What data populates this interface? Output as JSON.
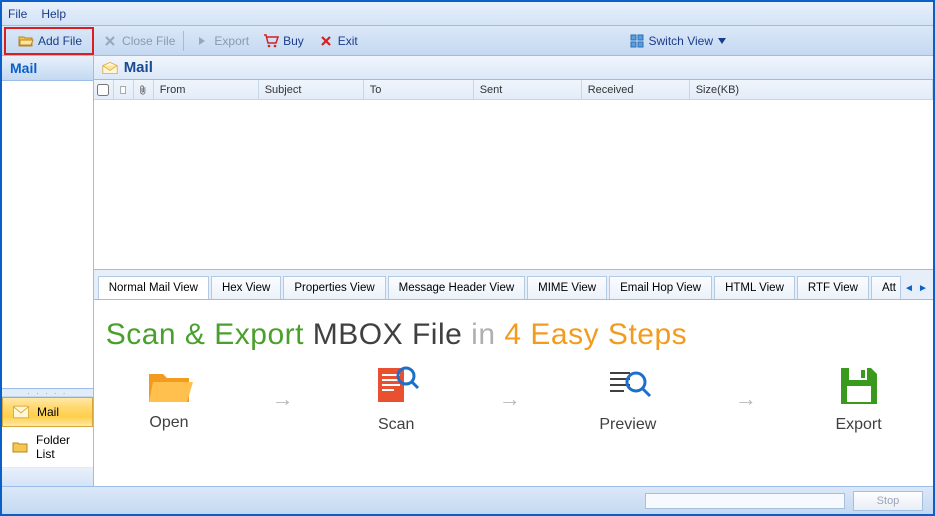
{
  "menu": {
    "file": "File",
    "help": "Help"
  },
  "toolbar": {
    "add_file": "Add File",
    "close_file": "Close File",
    "export": "Export",
    "buy": "Buy",
    "exit": "Exit",
    "switch_view": "Switch View"
  },
  "left": {
    "header": "Mail",
    "nav_mail": "Mail",
    "nav_folder_list": "Folder List"
  },
  "mail_pane": {
    "title": "Mail",
    "columns": {
      "from": "From",
      "subject": "Subject",
      "to": "To",
      "sent": "Sent",
      "received": "Received",
      "size": "Size(KB)"
    }
  },
  "tabs": {
    "normal": "Normal Mail View",
    "hex": "Hex View",
    "properties": "Properties View",
    "message_header": "Message Header View",
    "mime": "MIME View",
    "email_hop": "Email Hop View",
    "html": "HTML View",
    "rtf": "RTF View",
    "attachments": "Att"
  },
  "promo": {
    "scan_export": "Scan & Export",
    "mbox_file": "MBOX File",
    "in_word": "in",
    "four": "4",
    "easy_steps": "Easy Steps",
    "step_open": "Open",
    "step_scan": "Scan",
    "step_preview": "Preview",
    "step_export": "Export"
  },
  "statusbar": {
    "stop": "Stop"
  }
}
